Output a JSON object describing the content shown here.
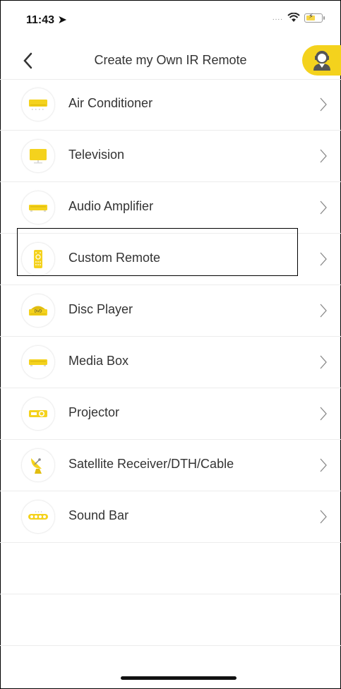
{
  "status_bar": {
    "time": "11:43",
    "signal": "....",
    "battery_color": "#f5d547"
  },
  "header": {
    "title": "Create my Own IR Remote",
    "back_icon": "chevron-left-icon",
    "support_icon": "support-agent-icon",
    "accent": "#f4d21d"
  },
  "list": {
    "items": [
      {
        "label": "Air Conditioner",
        "icon": "air-conditioner-icon"
      },
      {
        "label": "Television",
        "icon": "television-icon"
      },
      {
        "label": "Audio Amplifier",
        "icon": "audio-amplifier-icon"
      },
      {
        "label": "Custom Remote",
        "icon": "custom-remote-icon"
      },
      {
        "label": "Disc Player",
        "icon": "disc-player-icon",
        "icon_text": "DVD"
      },
      {
        "label": "Media Box",
        "icon": "media-box-icon"
      },
      {
        "label": "Projector",
        "icon": "projector-icon"
      },
      {
        "label": "Satellite Receiver/DTH/Cable",
        "icon": "satellite-dish-icon"
      },
      {
        "label": "Sound Bar",
        "icon": "sound-bar-icon"
      }
    ]
  }
}
